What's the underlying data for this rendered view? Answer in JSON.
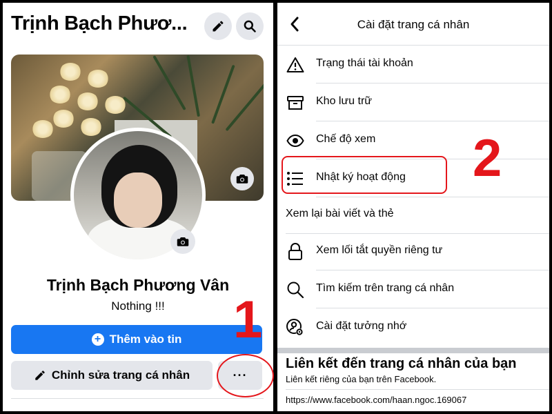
{
  "left": {
    "profile_header": "Trịnh Bạch Phươ...",
    "name": "Trịnh Bạch Phương Vân",
    "bio": "Nothing !!!",
    "add_story_label": "Thêm vào tin",
    "edit_profile_label": "Chỉnh sửa trang cá nhân",
    "more_label": "···",
    "annotation_1": "1"
  },
  "right": {
    "title": "Cài đặt trang cá nhân",
    "items": [
      {
        "label": "Trạng thái tài khoản",
        "icon": "warning-icon"
      },
      {
        "label": "Kho lưu trữ",
        "icon": "archive-icon"
      },
      {
        "label": "Chế độ xem",
        "icon": "eye-icon"
      },
      {
        "label": "Nhật ký hoạt động",
        "icon": "list-icon"
      },
      {
        "label": "Xem lại bài viết và thẻ",
        "icon": ""
      },
      {
        "label": "Xem lối tắt quyền riêng tư",
        "icon": "lock-icon"
      },
      {
        "label": "Tìm kiếm trên trang cá nhân",
        "icon": "search-icon"
      },
      {
        "label": "Cài đặt tưởng nhớ",
        "icon": "memorial-settings-icon"
      }
    ],
    "link_title": "Liên kết đến trang cá nhân của bạn",
    "link_subtitle": "Liên kết riêng của bạn trên Facebook.",
    "link_url": "https://www.facebook.com/haan.ngoc.169067",
    "annotation_2": "2"
  },
  "colors": {
    "primary": "#1877f2",
    "annotation": "#e4161b",
    "button_gray": "#e4e6eb"
  }
}
